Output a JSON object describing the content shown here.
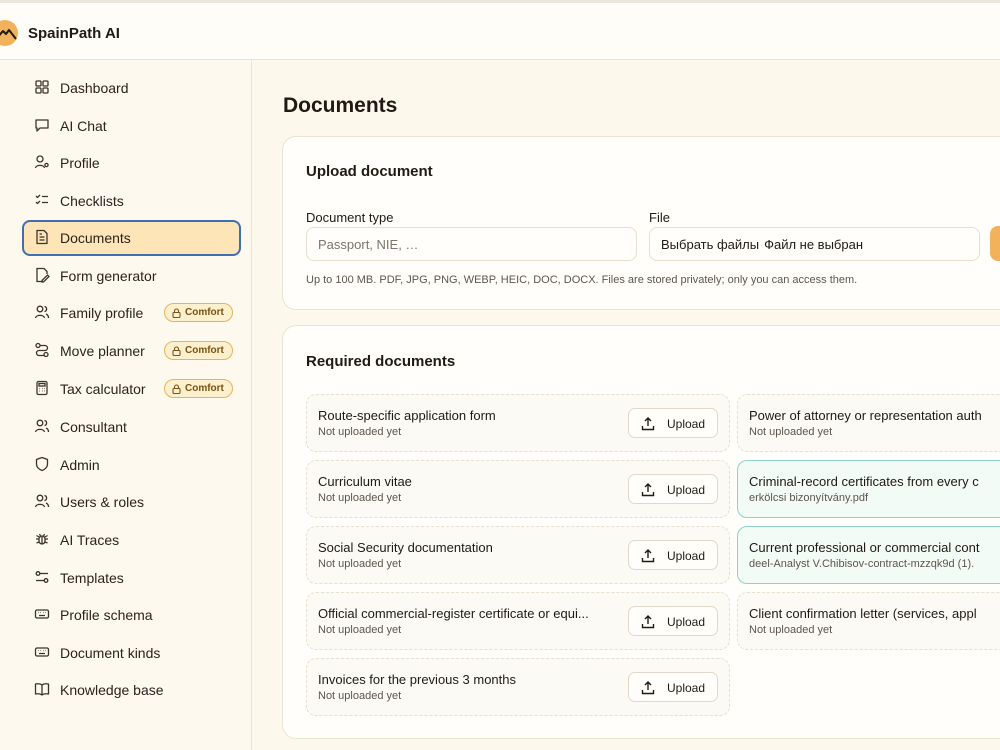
{
  "app": {
    "brand": "SpainPath AI"
  },
  "sidebar": {
    "items": [
      {
        "label": "Dashboard"
      },
      {
        "label": "AI Chat"
      },
      {
        "label": "Profile"
      },
      {
        "label": "Checklists"
      },
      {
        "label": "Documents",
        "active": true
      },
      {
        "label": "Form generator"
      },
      {
        "label": "Family profile",
        "badge": "Comfort"
      },
      {
        "label": "Move planner",
        "badge": "Comfort"
      },
      {
        "label": "Tax calculator",
        "badge": "Comfort"
      },
      {
        "label": "Consultant"
      },
      {
        "label": "Admin"
      },
      {
        "label": "Users & roles"
      },
      {
        "label": "AI Traces"
      },
      {
        "label": "Templates"
      },
      {
        "label": "Profile schema"
      },
      {
        "label": "Document kinds"
      },
      {
        "label": "Knowledge base"
      }
    ]
  },
  "main": {
    "title": "Documents",
    "upload": {
      "title": "Upload document",
      "doc_type_label": "Document type",
      "doc_type_placeholder": "Passport, NIE, …",
      "file_label": "File",
      "file_button": "Выбрать файлы",
      "file_status": "Файл не выбран",
      "hint": "Up to 100 MB. PDF, JPG, PNG, WEBP, HEIC, DOC, DOCX. Files are stored privately; only you can access them."
    },
    "required": {
      "title": "Required documents",
      "upload_label": "Upload",
      "left": [
        {
          "name": "Route-specific application form",
          "status": "Not uploaded yet"
        },
        {
          "name": "Curriculum vitae",
          "status": "Not uploaded yet"
        },
        {
          "name": "Social Security documentation",
          "status": "Not uploaded yet"
        },
        {
          "name": "Official commercial-register certificate or equi...",
          "status": "Not uploaded yet"
        },
        {
          "name": "Invoices for the previous 3 months",
          "status": "Not uploaded yet"
        }
      ],
      "right": [
        {
          "name": "Power of attorney or representation auth",
          "status": "Not uploaded yet",
          "uploaded": false
        },
        {
          "name": "Criminal-record certificates from every c",
          "status": "erkölcsi bizonyítvány.pdf",
          "uploaded": true
        },
        {
          "name": "Current professional or commercial cont",
          "status": "deel-Analyst V.Chibisov-contract-mzzqk9d (1).",
          "uploaded": true
        },
        {
          "name": "Client confirmation letter (services, appl",
          "status": "Not uploaded yet",
          "uploaded": false
        }
      ]
    }
  },
  "colors": {
    "accent": "#f2b25c",
    "active_border": "#3f6fb0",
    "active_bg": "#fde5b8",
    "uploaded_border": "#8fd3c6"
  },
  "icons": [
    "grid-icon",
    "chat-icon",
    "user-icon",
    "checklist-icon",
    "document-icon",
    "form-edit-icon",
    "users-icon",
    "route-icon",
    "calculator-icon",
    "users-icon",
    "shield-icon",
    "users-icon",
    "bug-icon",
    "sliders-icon",
    "keyboard-icon",
    "keyboard-icon",
    "book-icon",
    "lock-icon",
    "upload-icon"
  ]
}
